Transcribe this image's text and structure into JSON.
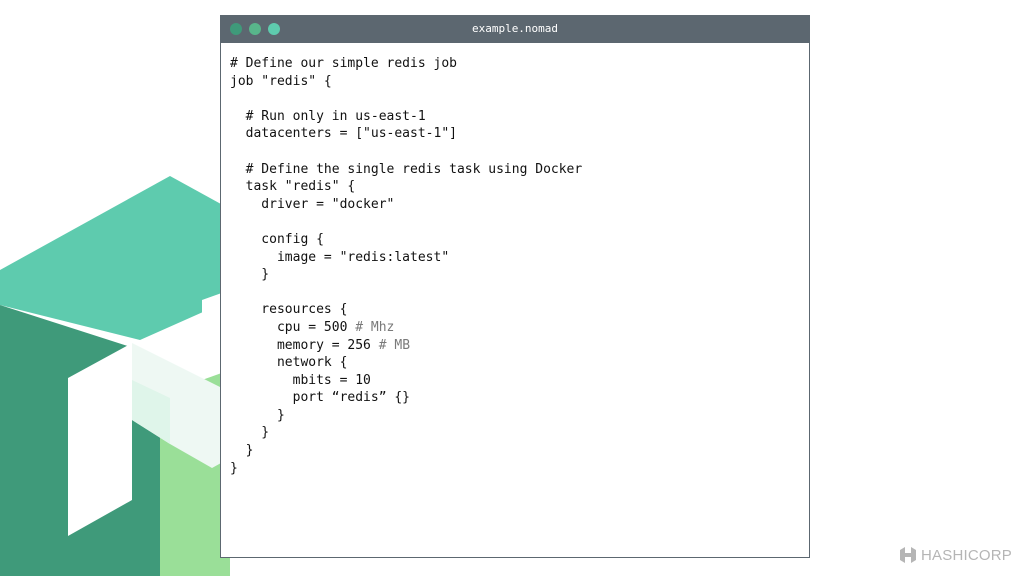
{
  "window": {
    "title": "example.nomad"
  },
  "code": {
    "lines": [
      {
        "code": "# Define our simple redis job",
        "comment": ""
      },
      {
        "code": "job \"redis\" {",
        "comment": ""
      },
      {
        "code": "",
        "comment": ""
      },
      {
        "code": "  # Run only in us-east-1",
        "comment": ""
      },
      {
        "code": "  datacenters = [\"us-east-1\"]",
        "comment": ""
      },
      {
        "code": "",
        "comment": ""
      },
      {
        "code": "  # Define the single redis task using Docker",
        "comment": ""
      },
      {
        "code": "  task \"redis\" {",
        "comment": ""
      },
      {
        "code": "    driver = \"docker\"",
        "comment": ""
      },
      {
        "code": "",
        "comment": ""
      },
      {
        "code": "    config {",
        "comment": ""
      },
      {
        "code": "      image = \"redis:latest\"",
        "comment": ""
      },
      {
        "code": "    }",
        "comment": ""
      },
      {
        "code": "",
        "comment": ""
      },
      {
        "code": "    resources {",
        "comment": ""
      },
      {
        "code": "      cpu = 500 ",
        "comment": "# Mhz"
      },
      {
        "code": "      memory = 256 ",
        "comment": "# MB"
      },
      {
        "code": "      network {",
        "comment": ""
      },
      {
        "code": "        mbits = 10",
        "comment": ""
      },
      {
        "code": "        port “redis” {}",
        "comment": ""
      },
      {
        "code": "      }",
        "comment": ""
      },
      {
        "code": "    }",
        "comment": ""
      },
      {
        "code": "  }",
        "comment": ""
      },
      {
        "code": "}",
        "comment": ""
      }
    ]
  },
  "brand": {
    "name": "HASHICORP",
    "icon": "hashicorp-logo-icon"
  },
  "colors": {
    "title_bar": "#5c6770",
    "accent_teal": "#5ecbae",
    "accent_green": "#58b68b",
    "accent_dark_green": "#3f9a7a",
    "accent_light_green": "#9adf98"
  }
}
